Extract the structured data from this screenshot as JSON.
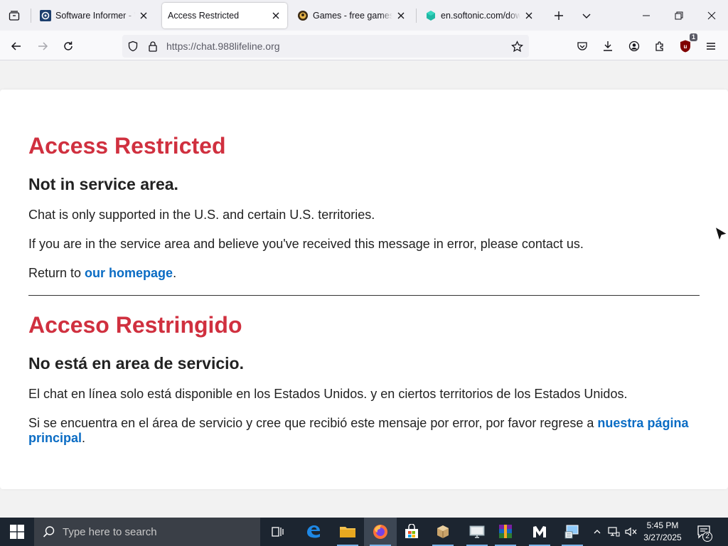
{
  "browser": {
    "tabs": [
      {
        "title": "Software Informer - Wi",
        "active": false
      },
      {
        "title": "Access Restricted",
        "active": true
      },
      {
        "title": "Games - free games on",
        "active": false
      },
      {
        "title": "en.softonic.com/down",
        "active": false
      }
    ],
    "url": "https://chat.988lifeline.org",
    "extension_badge": "1"
  },
  "page": {
    "en": {
      "title": "Access Restricted",
      "subtitle": "Not in service area.",
      "line1": "Chat is only supported in the U.S. and certain U.S. territories.",
      "line2": "If you are in the service area and believe you've received this message in error, please contact us.",
      "return_prefix": "Return to ",
      "return_link": "our homepage",
      "return_suffix": "."
    },
    "es": {
      "title": "Acceso Restringido",
      "subtitle": "No está en area de servicio.",
      "line1": "El chat en línea solo está disponible en los Estados Unidos. y en ciertos territorios de los Estados Unidos.",
      "line2_prefix": "Si se encuentra en el área de servicio y cree que recibió este mensaje por error, por favor regrese a ",
      "line2_link": "nuestra página principal",
      "line2_suffix": "."
    },
    "colors": {
      "heading": "#d0303f",
      "link": "#0a6cc4"
    }
  },
  "taskbar": {
    "search_placeholder": "Type here to search",
    "time": "5:45 PM",
    "date": "3/27/2025",
    "notification_count": "2"
  }
}
